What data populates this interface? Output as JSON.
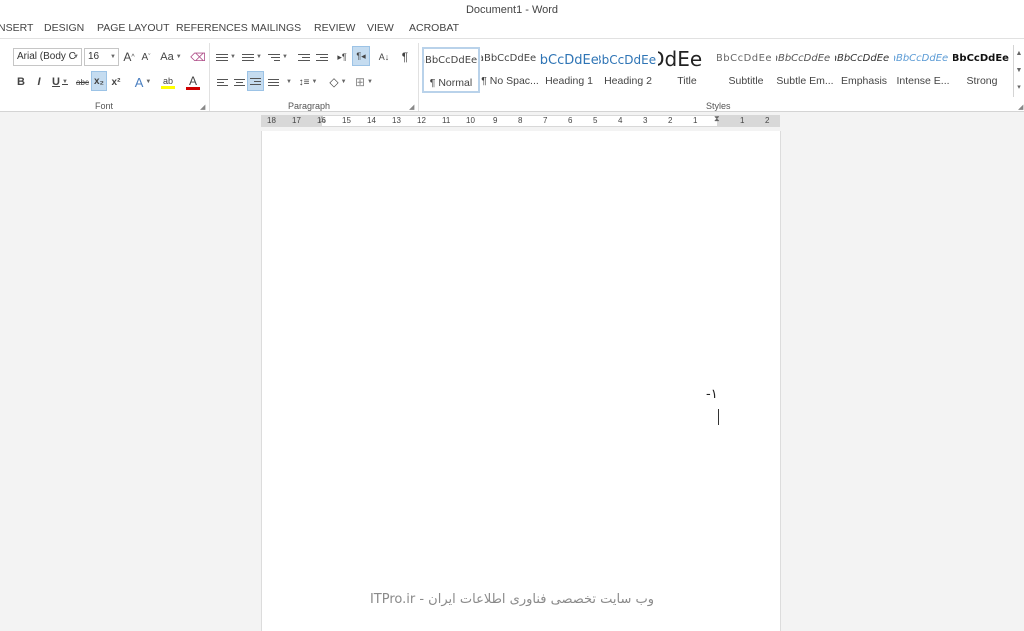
{
  "window": {
    "title": "Document1 - Word"
  },
  "tabs": [
    "NSERT",
    "DESIGN",
    "PAGE LAYOUT",
    "REFERENCES",
    "MAILINGS",
    "REVIEW",
    "VIEW",
    "ACROBAT"
  ],
  "font_group": {
    "label": "Font",
    "font_name": "Arial (Body C",
    "font_size": "16",
    "grow": "A",
    "shrink": "A",
    "case": "Aa",
    "bold": "B",
    "italic": "I",
    "underline": "U",
    "strike": "abc",
    "subscript": "x₂",
    "superscript": "x²",
    "effects": "A",
    "highlight": "ab",
    "font_color": "A",
    "highlight_color": "#ffff00",
    "font_color_bar": "#d00000"
  },
  "paragraph_group": {
    "label": "Paragraph",
    "sort": "A↓",
    "pilcrow": "¶",
    "ltr": "▸¶",
    "rtl": "¶◂"
  },
  "styles_group": {
    "label": "Styles",
    "items": [
      {
        "sample": "aBbCcDdEe",
        "name": "¶ Normal"
      },
      {
        "sample": "aBbCcDdEe",
        "name": "¶ No Spac..."
      },
      {
        "sample": "AaBbCcDdEe",
        "name": "Heading 1"
      },
      {
        "sample": "AaBbCcDdEe",
        "name": "Heading 2"
      },
      {
        "sample": "AaBbCcDdEe",
        "name": "Title"
      },
      {
        "sample": "AaBbCcDdEe",
        "name": "Subtitle"
      },
      {
        "sample": "aBbCcDdEe",
        "name": "Subtle Em..."
      },
      {
        "sample": "aBbCcDdEe",
        "name": "Emphasis"
      },
      {
        "sample": "aBbCcDdEe",
        "name": "Intense E..."
      },
      {
        "sample": "aBbCcDdEe",
        "name": "Strong"
      }
    ]
  },
  "ruler": {
    "ticks": [
      "18",
      "17",
      "16",
      "15",
      "14",
      "13",
      "12",
      "11",
      "10",
      "9",
      "8",
      "7",
      "6",
      "5",
      "4",
      "3",
      "2",
      "1",
      "",
      "1",
      "2"
    ]
  },
  "document": {
    "text": "-١"
  },
  "watermark": "ITPro.ir - وب سایت تخصصی فناوری اطلاعات ایران"
}
